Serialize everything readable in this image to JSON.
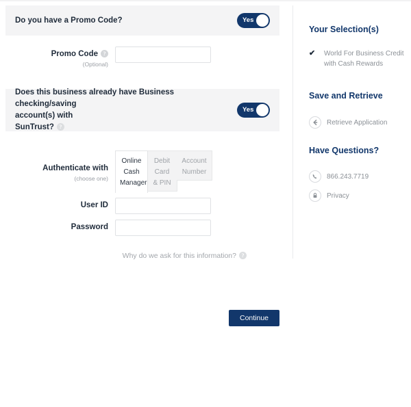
{
  "promo": {
    "question": "Do you have a Promo Code?",
    "toggle_label": "Yes",
    "label": "Promo Code",
    "sublabel": "(Optional)",
    "value": "",
    "help_glyph": "?"
  },
  "business": {
    "question_line1": "Does this business already have Business checking/saving",
    "question_line2": "account(s) with",
    "question_line3": "SunTrust?",
    "toggle_label": "Yes",
    "help_glyph": "?"
  },
  "auth": {
    "label": "Authenticate with",
    "sublabel": "(choose one)",
    "tabs": [
      {
        "label": "Online Cash Manager",
        "selected": true
      },
      {
        "label": "Debit Card & PIN",
        "selected": false
      },
      {
        "label": "Account Number",
        "selected": false
      }
    ],
    "userid_label": "User ID",
    "userid_value": "",
    "password_label": "Password",
    "password_value": "",
    "why_ask": "Why do we ask for this information?",
    "why_ask_help_glyph": "?"
  },
  "actions": {
    "continue_label": "Continue"
  },
  "sidebar": {
    "selections_heading": "Your Selection(s)",
    "selection_check": "✔",
    "selection_line1": "World For Business Credit",
    "selection_line2": "with Cash Rewards",
    "save_heading": "Save and Retrieve",
    "retrieve_label": "Retrieve Application",
    "questions_heading": "Have Questions?",
    "phone": "866.243.7719",
    "privacy": "Privacy"
  },
  "colors": {
    "navy": "#12376b",
    "panel_grey": "#f4f4f5",
    "text_dark": "#1f2b3a",
    "text_muted": "#8b9096"
  }
}
